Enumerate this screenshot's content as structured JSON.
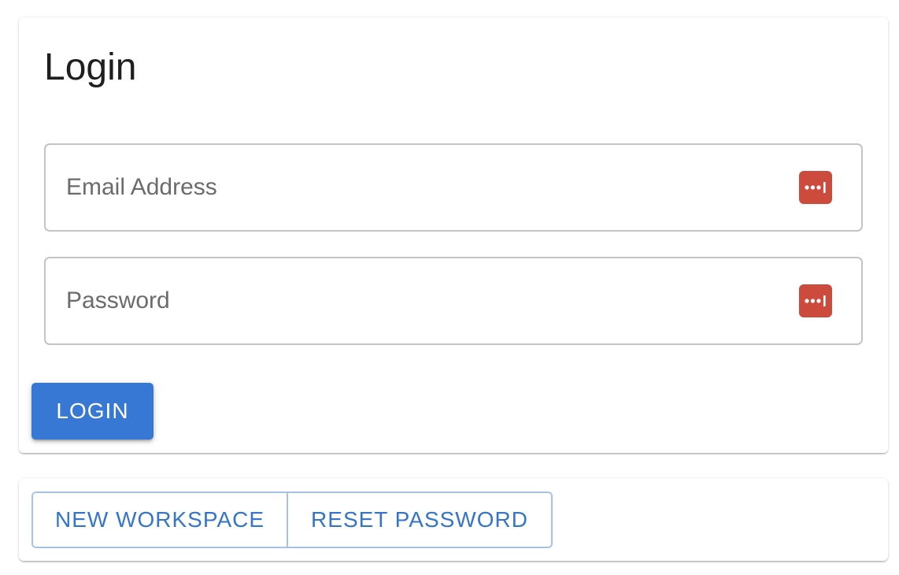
{
  "login": {
    "title": "Login",
    "email_placeholder": "Email Address",
    "password_placeholder": "Password",
    "submit_label": "LOGIN"
  },
  "actions": {
    "new_workspace_label": "NEW WORKSPACE",
    "reset_password_label": "RESET PASSWORD"
  },
  "icons": {
    "field_icon": "password-manager-icon",
    "field_icon_color": "#cc4b3c"
  },
  "colors": {
    "primary": "#3778d4",
    "outline_text": "#3474cc",
    "outline_border": "#a7c1e6"
  }
}
